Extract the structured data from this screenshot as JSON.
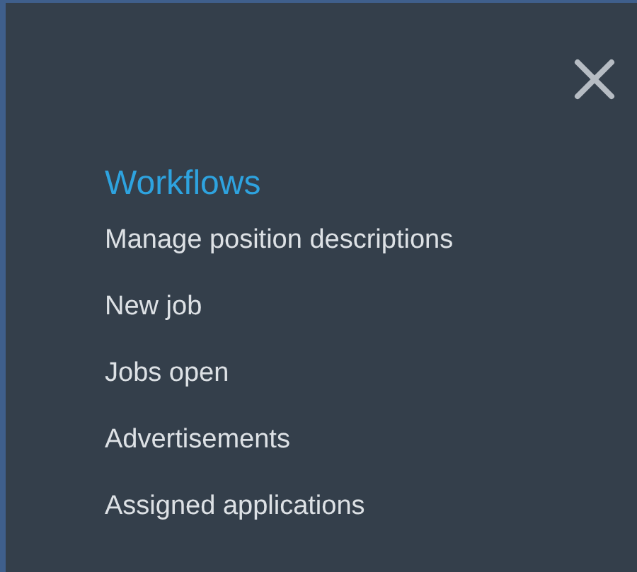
{
  "menu": {
    "title": "Workflows",
    "items": [
      {
        "label": "Manage position descriptions"
      },
      {
        "label": "New job"
      },
      {
        "label": "Jobs open"
      },
      {
        "label": "Advertisements"
      },
      {
        "label": "Assigned applications"
      }
    ]
  }
}
